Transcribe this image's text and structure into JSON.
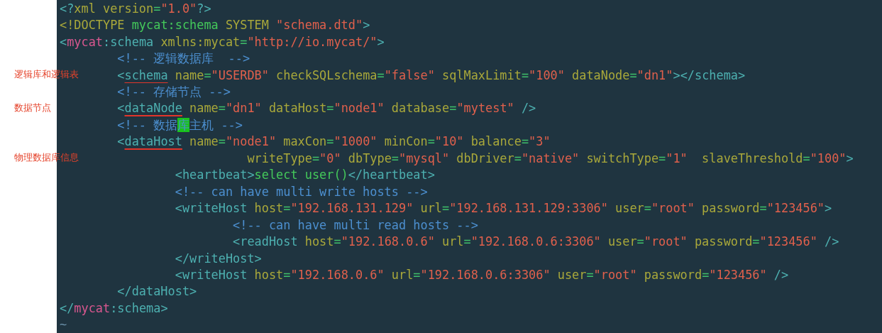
{
  "lines": [
    {
      "tokens": [
        {
          "text": "<?",
          "kind": "punct"
        },
        {
          "text": "xml version",
          "kind": "attr"
        },
        {
          "text": "=",
          "kind": "eq"
        },
        {
          "text": "\"1.0\"",
          "kind": "str"
        },
        {
          "text": "?>",
          "kind": "punct"
        }
      ]
    },
    {
      "tokens": [
        {
          "text": "<!DOCTYPE ",
          "kind": "attr"
        },
        {
          "text": "mycat:schema ",
          "kind": "text"
        },
        {
          "text": "SYSTEM ",
          "kind": "attr"
        },
        {
          "text": "\"schema.dtd\"",
          "kind": "str"
        },
        {
          "text": ">",
          "kind": "punct"
        }
      ]
    },
    {
      "tokens": [
        {
          "text": "<",
          "kind": "punct"
        },
        {
          "text": "mycat",
          "kind": "ns"
        },
        {
          "text": ":schema ",
          "kind": "tag"
        },
        {
          "text": "xmlns:mycat",
          "kind": "attr"
        },
        {
          "text": "=",
          "kind": "eq"
        },
        {
          "text": "\"http://io.mycat/\"",
          "kind": "str"
        },
        {
          "text": ">",
          "kind": "punct"
        }
      ]
    },
    {
      "tokens": [
        {
          "text": "        <!-- 逻辑数据库  -->",
          "kind": "comment"
        }
      ]
    },
    {
      "note": "逻辑库和逻辑表",
      "tokens": [
        {
          "text": "        <",
          "kind": "punct"
        },
        {
          "text": "schema",
          "kind": "tag_marked"
        },
        {
          "text": " name",
          "kind": "attr"
        },
        {
          "text": "=",
          "kind": "eq"
        },
        {
          "text": "\"USERDB\"",
          "kind": "str"
        },
        {
          "text": " checkSQLschema",
          "kind": "attr"
        },
        {
          "text": "=",
          "kind": "eq"
        },
        {
          "text": "\"false\"",
          "kind": "str"
        },
        {
          "text": " sqlMaxLimit",
          "kind": "attr"
        },
        {
          "text": "=",
          "kind": "eq"
        },
        {
          "text": "\"100\"",
          "kind": "str"
        },
        {
          "text": " dataNode",
          "kind": "attr"
        },
        {
          "text": "=",
          "kind": "eq"
        },
        {
          "text": "\"dn1\"",
          "kind": "str"
        },
        {
          "text": "></schema>",
          "kind": "punct"
        }
      ]
    },
    {
      "tokens": [
        {
          "text": "        <!-- 存储节点 -->",
          "kind": "comment"
        }
      ]
    },
    {
      "note": "数据节点",
      "tokens": [
        {
          "text": "        <",
          "kind": "punct"
        },
        {
          "text": "dataNode",
          "kind": "tag_marked"
        },
        {
          "text": " name",
          "kind": "attr"
        },
        {
          "text": "=",
          "kind": "eq"
        },
        {
          "text": "\"dn1\"",
          "kind": "str"
        },
        {
          "text": " dataHost",
          "kind": "attr"
        },
        {
          "text": "=",
          "kind": "eq"
        },
        {
          "text": "\"node1\"",
          "kind": "str"
        },
        {
          "text": " database",
          "kind": "attr"
        },
        {
          "text": "=",
          "kind": "eq"
        },
        {
          "text": "\"mytest\"",
          "kind": "str"
        },
        {
          "text": " />",
          "kind": "punct"
        }
      ]
    },
    {
      "tokens": [
        {
          "text": "        <!-- 数据",
          "kind": "comment"
        },
        {
          "text": "库",
          "kind": "highlight"
        },
        {
          "text": "主机 -->",
          "kind": "comment"
        }
      ]
    },
    {
      "tokens": [
        {
          "text": "        <",
          "kind": "punct"
        },
        {
          "text": "dataHost",
          "kind": "tag_marked"
        },
        {
          "text": " name",
          "kind": "attr"
        },
        {
          "text": "=",
          "kind": "eq"
        },
        {
          "text": "\"node1\"",
          "kind": "str"
        },
        {
          "text": " maxCon",
          "kind": "attr"
        },
        {
          "text": "=",
          "kind": "eq"
        },
        {
          "text": "\"1000\"",
          "kind": "str"
        },
        {
          "text": " minCon",
          "kind": "attr"
        },
        {
          "text": "=",
          "kind": "eq"
        },
        {
          "text": "\"10\"",
          "kind": "str"
        },
        {
          "text": " balance",
          "kind": "attr"
        },
        {
          "text": "=",
          "kind": "eq"
        },
        {
          "text": "\"3\"",
          "kind": "str"
        }
      ]
    },
    {
      "note": "物理数据库信息",
      "tokens": [
        {
          "text": "                          writeType",
          "kind": "attr"
        },
        {
          "text": "=",
          "kind": "eq"
        },
        {
          "text": "\"0\"",
          "kind": "str"
        },
        {
          "text": " dbType",
          "kind": "attr"
        },
        {
          "text": "=",
          "kind": "eq"
        },
        {
          "text": "\"mysql\"",
          "kind": "str"
        },
        {
          "text": " dbDriver",
          "kind": "attr"
        },
        {
          "text": "=",
          "kind": "eq"
        },
        {
          "text": "\"native\"",
          "kind": "str"
        },
        {
          "text": " switchType",
          "kind": "attr"
        },
        {
          "text": "=",
          "kind": "eq"
        },
        {
          "text": "\"1\"",
          "kind": "str"
        },
        {
          "text": "  slaveThreshold",
          "kind": "attr"
        },
        {
          "text": "=",
          "kind": "eq"
        },
        {
          "text": "\"100\"",
          "kind": "str"
        },
        {
          "text": ">",
          "kind": "punct"
        }
      ]
    },
    {
      "tokens": [
        {
          "text": "                <heartbeat>",
          "kind": "punct"
        },
        {
          "text": "select user()",
          "kind": "text"
        },
        {
          "text": "</heartbeat>",
          "kind": "punct"
        }
      ]
    },
    {
      "tokens": [
        {
          "text": "                <!-- can have multi write hosts -->",
          "kind": "comment"
        }
      ]
    },
    {
      "tokens": [
        {
          "text": "                <writeHost",
          "kind": "punct"
        },
        {
          "text": " host",
          "kind": "attr"
        },
        {
          "text": "=",
          "kind": "eq"
        },
        {
          "text": "\"192.168.131.129\"",
          "kind": "str"
        },
        {
          "text": " url",
          "kind": "attr"
        },
        {
          "text": "=",
          "kind": "eq"
        },
        {
          "text": "\"192.168.131.129:3306\"",
          "kind": "str"
        },
        {
          "text": " user",
          "kind": "attr"
        },
        {
          "text": "=",
          "kind": "eq"
        },
        {
          "text": "\"root\"",
          "kind": "str"
        },
        {
          "text": " password",
          "kind": "attr"
        },
        {
          "text": "=",
          "kind": "eq"
        },
        {
          "text": "\"123456\"",
          "kind": "str"
        },
        {
          "text": ">",
          "kind": "punct"
        }
      ]
    },
    {
      "tokens": [
        {
          "text": "                        <!-- can have multi read hosts -->",
          "kind": "comment"
        }
      ]
    },
    {
      "tokens": [
        {
          "text": "                        <readHost",
          "kind": "punct"
        },
        {
          "text": " host",
          "kind": "attr"
        },
        {
          "text": "=",
          "kind": "eq"
        },
        {
          "text": "\"192.168.0.6\"",
          "kind": "str"
        },
        {
          "text": " url",
          "kind": "attr"
        },
        {
          "text": "=",
          "kind": "eq"
        },
        {
          "text": "\"192.168.0.6:3306\"",
          "kind": "str"
        },
        {
          "text": " user",
          "kind": "attr"
        },
        {
          "text": "=",
          "kind": "eq"
        },
        {
          "text": "\"root\"",
          "kind": "str"
        },
        {
          "text": " password",
          "kind": "attr"
        },
        {
          "text": "=",
          "kind": "eq"
        },
        {
          "text": "\"123456\"",
          "kind": "str"
        },
        {
          "text": " />",
          "kind": "punct"
        }
      ]
    },
    {
      "tokens": [
        {
          "text": "                </writeHost>",
          "kind": "punct"
        }
      ]
    },
    {
      "tokens": [
        {
          "text": "                <writeHost",
          "kind": "punct"
        },
        {
          "text": " host",
          "kind": "attr"
        },
        {
          "text": "=",
          "kind": "eq"
        },
        {
          "text": "\"192.168.0.6\"",
          "kind": "str"
        },
        {
          "text": " url",
          "kind": "attr"
        },
        {
          "text": "=",
          "kind": "eq"
        },
        {
          "text": "\"192.168.0.6:3306\"",
          "kind": "str"
        },
        {
          "text": " user",
          "kind": "attr"
        },
        {
          "text": "=",
          "kind": "eq"
        },
        {
          "text": "\"root\"",
          "kind": "str"
        },
        {
          "text": " password",
          "kind": "attr"
        },
        {
          "text": "=",
          "kind": "eq"
        },
        {
          "text": "\"123456\"",
          "kind": "str"
        },
        {
          "text": " />",
          "kind": "punct"
        }
      ]
    },
    {
      "tokens": [
        {
          "text": "        </dataHost>",
          "kind": "punct"
        }
      ]
    },
    {
      "tokens": [
        {
          "text": "</",
          "kind": "punct"
        },
        {
          "text": "mycat",
          "kind": "ns"
        },
        {
          "text": ":schema>",
          "kind": "tag"
        }
      ]
    },
    {
      "tokens": [
        {
          "text": "~",
          "kind": "tilde"
        }
      ]
    }
  ]
}
